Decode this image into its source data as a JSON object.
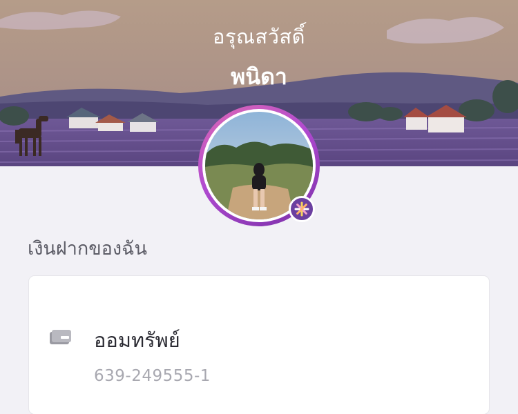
{
  "header": {
    "greeting": "อรุณสวัสดิ์",
    "user_name": "พนิดา"
  },
  "section": {
    "title": "เงินฝากของฉัน"
  },
  "account": {
    "type": "ออมทรัพย์",
    "number": "639-249555-1"
  },
  "colors": {
    "avatar_ring": "#c04ec8",
    "badge": "#6b3fa0",
    "background": "#f2f1f6"
  },
  "icons": {
    "card": "card-icon",
    "badge": "sparkle-icon"
  }
}
